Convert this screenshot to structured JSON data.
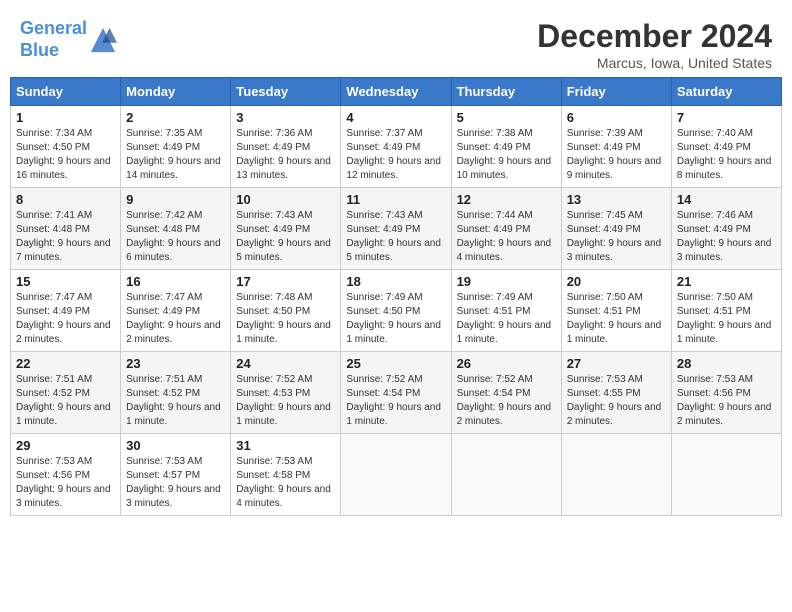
{
  "logo": {
    "line1": "General",
    "line2": "Blue"
  },
  "title": "December 2024",
  "subtitle": "Marcus, Iowa, United States",
  "days_of_week": [
    "Sunday",
    "Monday",
    "Tuesday",
    "Wednesday",
    "Thursday",
    "Friday",
    "Saturday"
  ],
  "weeks": [
    [
      {
        "day": "1",
        "info": "Sunrise: 7:34 AM\nSunset: 4:50 PM\nDaylight: 9 hours and 16 minutes."
      },
      {
        "day": "2",
        "info": "Sunrise: 7:35 AM\nSunset: 4:49 PM\nDaylight: 9 hours and 14 minutes."
      },
      {
        "day": "3",
        "info": "Sunrise: 7:36 AM\nSunset: 4:49 PM\nDaylight: 9 hours and 13 minutes."
      },
      {
        "day": "4",
        "info": "Sunrise: 7:37 AM\nSunset: 4:49 PM\nDaylight: 9 hours and 12 minutes."
      },
      {
        "day": "5",
        "info": "Sunrise: 7:38 AM\nSunset: 4:49 PM\nDaylight: 9 hours and 10 minutes."
      },
      {
        "day": "6",
        "info": "Sunrise: 7:39 AM\nSunset: 4:49 PM\nDaylight: 9 hours and 9 minutes."
      },
      {
        "day": "7",
        "info": "Sunrise: 7:40 AM\nSunset: 4:49 PM\nDaylight: 9 hours and 8 minutes."
      }
    ],
    [
      {
        "day": "8",
        "info": "Sunrise: 7:41 AM\nSunset: 4:48 PM\nDaylight: 9 hours and 7 minutes."
      },
      {
        "day": "9",
        "info": "Sunrise: 7:42 AM\nSunset: 4:48 PM\nDaylight: 9 hours and 6 minutes."
      },
      {
        "day": "10",
        "info": "Sunrise: 7:43 AM\nSunset: 4:49 PM\nDaylight: 9 hours and 5 minutes."
      },
      {
        "day": "11",
        "info": "Sunrise: 7:43 AM\nSunset: 4:49 PM\nDaylight: 9 hours and 5 minutes."
      },
      {
        "day": "12",
        "info": "Sunrise: 7:44 AM\nSunset: 4:49 PM\nDaylight: 9 hours and 4 minutes."
      },
      {
        "day": "13",
        "info": "Sunrise: 7:45 AM\nSunset: 4:49 PM\nDaylight: 9 hours and 3 minutes."
      },
      {
        "day": "14",
        "info": "Sunrise: 7:46 AM\nSunset: 4:49 PM\nDaylight: 9 hours and 3 minutes."
      }
    ],
    [
      {
        "day": "15",
        "info": "Sunrise: 7:47 AM\nSunset: 4:49 PM\nDaylight: 9 hours and 2 minutes."
      },
      {
        "day": "16",
        "info": "Sunrise: 7:47 AM\nSunset: 4:49 PM\nDaylight: 9 hours and 2 minutes."
      },
      {
        "day": "17",
        "info": "Sunrise: 7:48 AM\nSunset: 4:50 PM\nDaylight: 9 hours and 1 minute."
      },
      {
        "day": "18",
        "info": "Sunrise: 7:49 AM\nSunset: 4:50 PM\nDaylight: 9 hours and 1 minute."
      },
      {
        "day": "19",
        "info": "Sunrise: 7:49 AM\nSunset: 4:51 PM\nDaylight: 9 hours and 1 minute."
      },
      {
        "day": "20",
        "info": "Sunrise: 7:50 AM\nSunset: 4:51 PM\nDaylight: 9 hours and 1 minute."
      },
      {
        "day": "21",
        "info": "Sunrise: 7:50 AM\nSunset: 4:51 PM\nDaylight: 9 hours and 1 minute."
      }
    ],
    [
      {
        "day": "22",
        "info": "Sunrise: 7:51 AM\nSunset: 4:52 PM\nDaylight: 9 hours and 1 minute."
      },
      {
        "day": "23",
        "info": "Sunrise: 7:51 AM\nSunset: 4:52 PM\nDaylight: 9 hours and 1 minute."
      },
      {
        "day": "24",
        "info": "Sunrise: 7:52 AM\nSunset: 4:53 PM\nDaylight: 9 hours and 1 minute."
      },
      {
        "day": "25",
        "info": "Sunrise: 7:52 AM\nSunset: 4:54 PM\nDaylight: 9 hours and 1 minute."
      },
      {
        "day": "26",
        "info": "Sunrise: 7:52 AM\nSunset: 4:54 PM\nDaylight: 9 hours and 2 minutes."
      },
      {
        "day": "27",
        "info": "Sunrise: 7:53 AM\nSunset: 4:55 PM\nDaylight: 9 hours and 2 minutes."
      },
      {
        "day": "28",
        "info": "Sunrise: 7:53 AM\nSunset: 4:56 PM\nDaylight: 9 hours and 2 minutes."
      }
    ],
    [
      {
        "day": "29",
        "info": "Sunrise: 7:53 AM\nSunset: 4:56 PM\nDaylight: 9 hours and 3 minutes."
      },
      {
        "day": "30",
        "info": "Sunrise: 7:53 AM\nSunset: 4:57 PM\nDaylight: 9 hours and 3 minutes."
      },
      {
        "day": "31",
        "info": "Sunrise: 7:53 AM\nSunset: 4:58 PM\nDaylight: 9 hours and 4 minutes."
      },
      {
        "day": "",
        "info": ""
      },
      {
        "day": "",
        "info": ""
      },
      {
        "day": "",
        "info": ""
      },
      {
        "day": "",
        "info": ""
      }
    ]
  ]
}
